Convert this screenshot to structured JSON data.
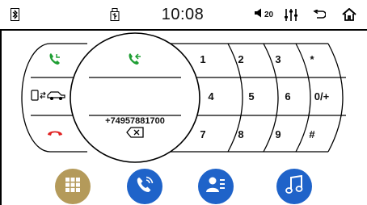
{
  "status_bar": {
    "bluetooth_icon": "bluetooth-icon",
    "usb_icon": "usb-icon",
    "time": "10:08",
    "volume_icon": "speaker-icon",
    "volume_level": "20",
    "equalizer_icon": "equalizer-icon",
    "back_icon": "back-arrow-icon",
    "home_icon": "home-icon"
  },
  "dialer": {
    "dialed_number": "+74957881700",
    "keys": [
      {
        "label": "1"
      },
      {
        "label": "2"
      },
      {
        "label": "3"
      },
      {
        "label": "*"
      },
      {
        "label": "4"
      },
      {
        "label": "5"
      },
      {
        "label": "6"
      },
      {
        "label": "0/+"
      },
      {
        "label": "7"
      },
      {
        "label": "8"
      },
      {
        "label": "9"
      },
      {
        "label": "#"
      }
    ]
  },
  "colors": {
    "call_green": "#1e9e33",
    "hangup_red": "#e02020",
    "app_menu": "#b49a5a",
    "app_blue": "#1f63c9"
  },
  "bottom_nav": [
    {
      "icon": "app-grid-icon"
    },
    {
      "icon": "phone-calls-icon"
    },
    {
      "icon": "contacts-icon"
    },
    {
      "icon": "music-note-icon"
    }
  ]
}
